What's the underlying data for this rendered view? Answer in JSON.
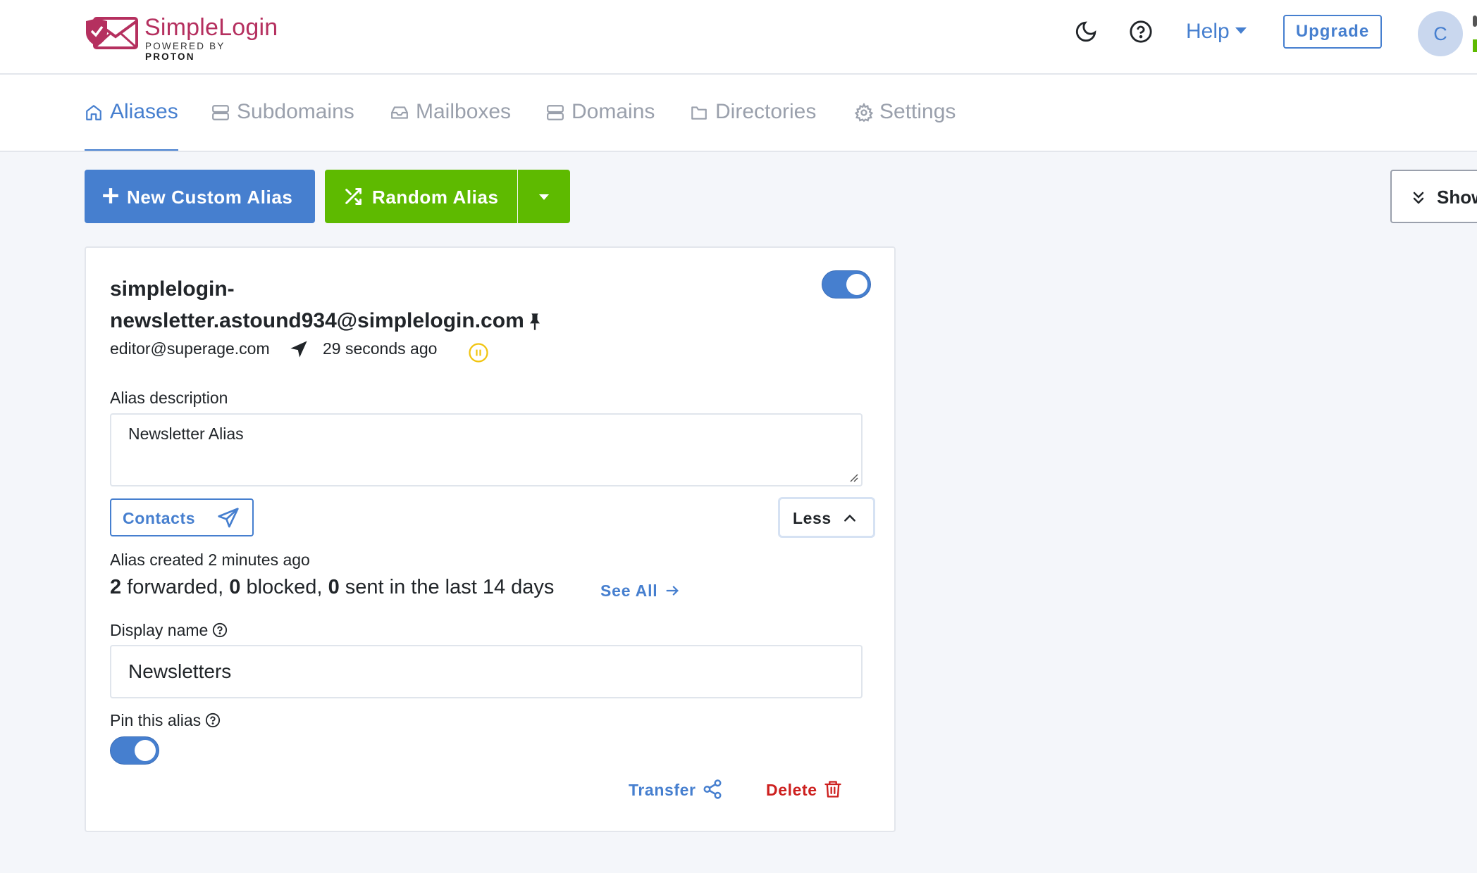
{
  "brand": {
    "name": "SimpleLogin",
    "powered_prefix": "POWERED BY",
    "powered_name": "PROTON",
    "color": "#b5305f"
  },
  "header": {
    "icons": [
      "moon-icon",
      "help-circle-icon"
    ],
    "help_label": "Help",
    "upgrade_label": "Upgrade",
    "avatar_initial": "C"
  },
  "tabs": [
    {
      "label": "Aliases",
      "icon": "home-icon",
      "active": true
    },
    {
      "label": "Subdomains",
      "icon": "server-icon",
      "active": false
    },
    {
      "label": "Mailboxes",
      "icon": "inbox-icon",
      "active": false
    },
    {
      "label": "Domains",
      "icon": "server-icon",
      "active": false
    },
    {
      "label": "Directories",
      "icon": "folder-icon",
      "active": false
    },
    {
      "label": "Settings",
      "icon": "gear-icon",
      "active": false
    }
  ],
  "actions": {
    "new_custom_alias": "New Custom Alias",
    "random_alias": "Random Alias",
    "show_label": "Show"
  },
  "alias": {
    "email_line1": "simplelogin-",
    "email_line2": "newsletter.astound934@simplelogin.com",
    "enabled": true,
    "mailbox": "editor@superage.com",
    "last_activity": "29 seconds ago",
    "description_label": "Alias description",
    "description_value": "Newsletter Alias",
    "contacts_label": "Contacts",
    "less_label": "Less",
    "created_text": "Alias created 2 minutes ago",
    "stats": {
      "forwarded": "2",
      "forwarded_text": " forwarded, ",
      "blocked": "0",
      "blocked_text": " blocked, ",
      "sent": "0",
      "sent_text": " sent in the last 14 days"
    },
    "see_all_label": "See All",
    "display_name_label": "Display name",
    "display_name_value": "Newsletters",
    "pin_label": "Pin this alias",
    "pinned": true,
    "transfer_label": "Transfer",
    "delete_label": "Delete"
  },
  "colors": {
    "primary": "#467fcf",
    "success": "#5eba00",
    "danger": "#cd201f",
    "warning": "#f1c40f",
    "muted": "#9aa0ac"
  }
}
